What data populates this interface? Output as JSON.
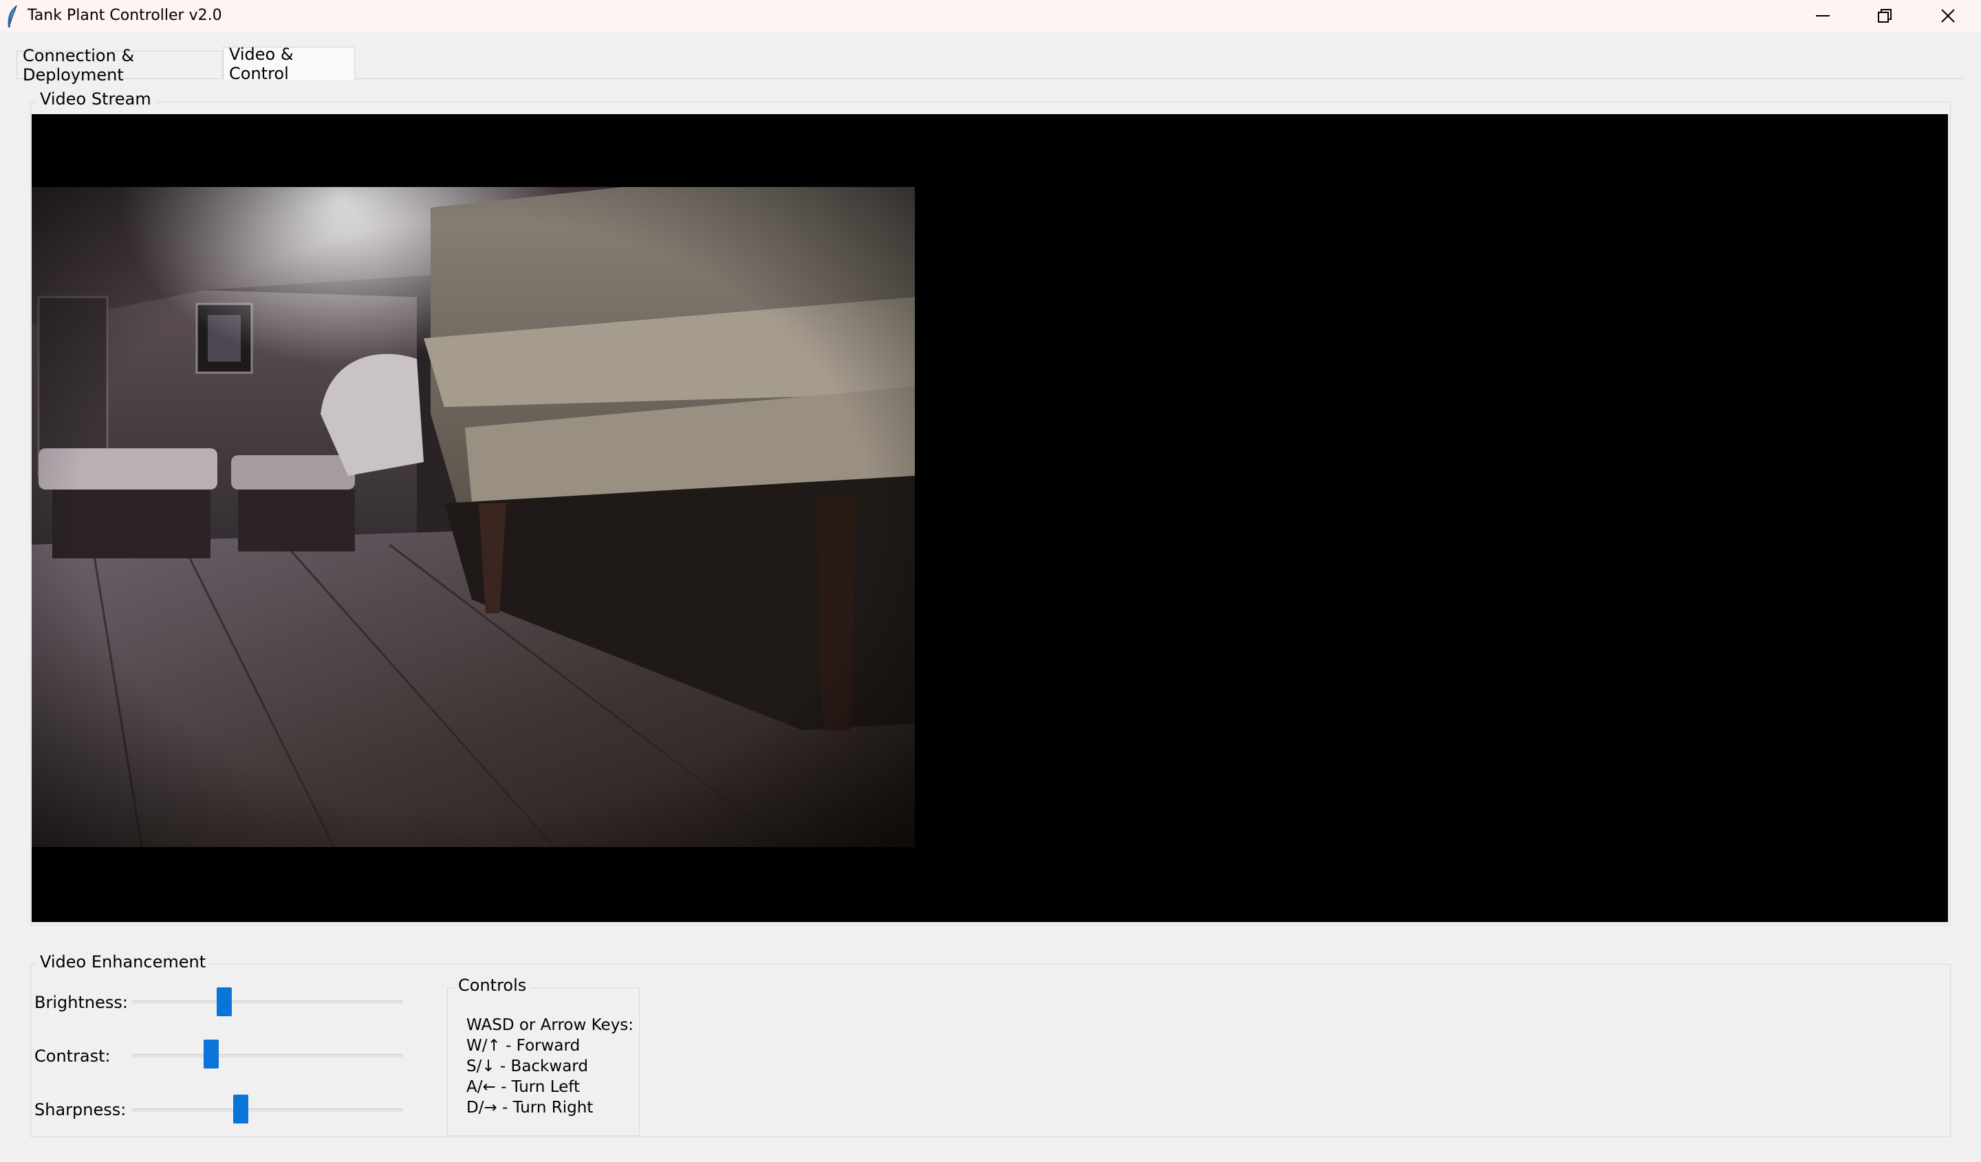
{
  "window": {
    "title": "Tank Plant Controller v2.0"
  },
  "tabs": [
    {
      "label": "Connection & Deployment",
      "active": false
    },
    {
      "label": "Video & Control",
      "active": true
    }
  ],
  "video": {
    "group_label": "Video Stream"
  },
  "enhancement": {
    "group_label": "Video Enhancement",
    "sliders": [
      {
        "label": "Brightness:",
        "value": 0.34
      },
      {
        "label": "Contrast:",
        "value": 0.29
      },
      {
        "label": "Sharpness:",
        "value": 0.4
      }
    ]
  },
  "controls": {
    "group_label": "Controls",
    "heading": "WASD or Arrow Keys:",
    "lines": [
      "W/↑ - Forward",
      "S/↓ - Backward",
      "A/← - Turn Left",
      "D/→ - Turn Right"
    ]
  },
  "colors": {
    "accent": "#0a74d9",
    "titlebar_bg": "#fdf4f3",
    "video_bg": "#000000"
  }
}
